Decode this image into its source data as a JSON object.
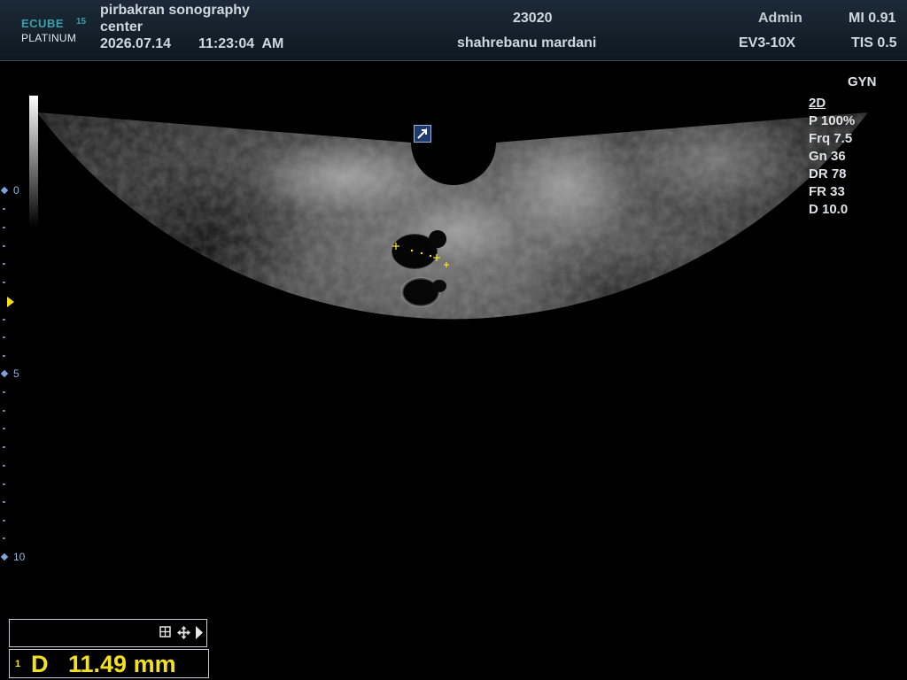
{
  "header": {
    "logo_brand": "ECUBE",
    "logo_number": "15",
    "logo_edition": "PLATINUM",
    "hospital_line1": "pirbakran sonography",
    "hospital_line2": "center",
    "date": "2026.07.14",
    "time": "11:23:04  AM",
    "patient_id": "23020",
    "patient_name": "shahrebanu mardani",
    "user": "Admin",
    "probe": "EV3-10X",
    "mi": "MI 0.91",
    "tis": "TIS 0.5"
  },
  "depth_scale": {
    "labels": [
      "0",
      "5",
      "10"
    ]
  },
  "params": {
    "application": "GYN",
    "mode": "2D",
    "power": "P 100%",
    "frequency": "Frq 7.5",
    "gain": "Gn 36",
    "dynamic_range": "DR 78",
    "frame_rate": "FR 33",
    "depth": "D 10.0"
  },
  "measurement": {
    "index": "1",
    "label": "D",
    "value": "11.49 mm"
  },
  "icons": {
    "grid": "grid-icon",
    "move": "move-icon",
    "next": "play-arrow-icon",
    "orientation": "orientation-marker-icon"
  },
  "colors": {
    "measurement": "#f3e21b",
    "scale": "#7fa3dd",
    "header_bg": "#16222d"
  }
}
